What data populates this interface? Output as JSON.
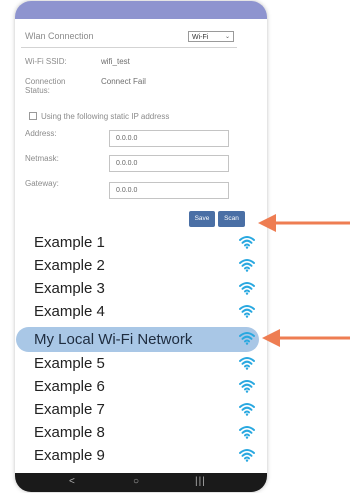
{
  "settings": {
    "title": "Wlan Connection",
    "mode_value": "Wi-Fi",
    "ssid_label": "Wi-Fi SSID:",
    "ssid_value": "wifi_test",
    "status_label_line1": "Connection",
    "status_label_line2": "Status:",
    "status_value": "Connect Fail",
    "static_ip_label": "Using the following static IP address",
    "static_ip_checked": false,
    "address_label": "Address:",
    "address_value": "0.0.0.0",
    "netmask_label": "Netmask:",
    "netmask_value": "0.0.0.0",
    "gateway_label": "Gateway:",
    "gateway_value": "0.0.0.0",
    "save_label": "Save",
    "scan_label": "Scan"
  },
  "networks": [
    {
      "name": "Example 1"
    },
    {
      "name": "Example 2"
    },
    {
      "name": "Example 3"
    },
    {
      "name": "Example 4"
    },
    {
      "name": "My Local Wi-Fi Network",
      "selected": true
    },
    {
      "name": "Example 5"
    },
    {
      "name": "Example 6"
    },
    {
      "name": "Example 7"
    },
    {
      "name": "Example 8"
    },
    {
      "name": "Example 9"
    }
  ],
  "nav": {
    "back": "<",
    "home": "○",
    "recents": "|||"
  },
  "colors": {
    "header_bar": "#8e94cf",
    "button": "#4a6fa5",
    "selected_row": "#a9c7e6",
    "wifi_icon": "#29a8e0",
    "annotation_arrow": "#ee7d52",
    "nav_bar": "#1a1a1a"
  }
}
